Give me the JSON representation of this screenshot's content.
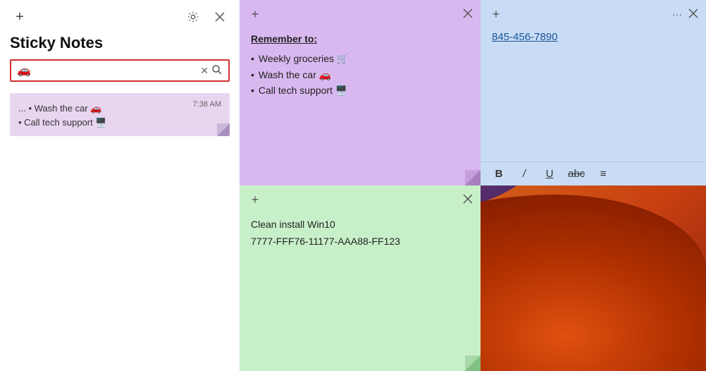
{
  "background": {
    "description": "Windows desktop background with purple mountains and orange rock formations"
  },
  "sidebar": {
    "add_label": "+",
    "title": "Sticky Notes",
    "search_placeholder": "",
    "search_emoji": "🚗",
    "search_clear": "×",
    "note_items": [
      {
        "time": "7:38 AM",
        "preview_line1": "... • Wash the car 🚗",
        "preview_line2": "• Call tech support 🖥️"
      }
    ]
  },
  "note_purple": {
    "title": "Remember to:",
    "items": [
      "Weekly groceries 🛒",
      "Wash the car 🚗",
      "Call tech support 🖥️"
    ]
  },
  "note_blue": {
    "content": "845-456-7890",
    "toolbar": {
      "bold": "B",
      "italic": "/",
      "underline": "U",
      "strikethrough": "abc",
      "list": "≡"
    }
  },
  "note_green": {
    "line1": "Clean install Win10",
    "line2": "7777-FFF76-11177-AAA88-FF123"
  },
  "icons": {
    "add": "+",
    "gear": "⚙",
    "close": "✕",
    "dots": "···",
    "search": "🔍",
    "clear": "✕"
  }
}
